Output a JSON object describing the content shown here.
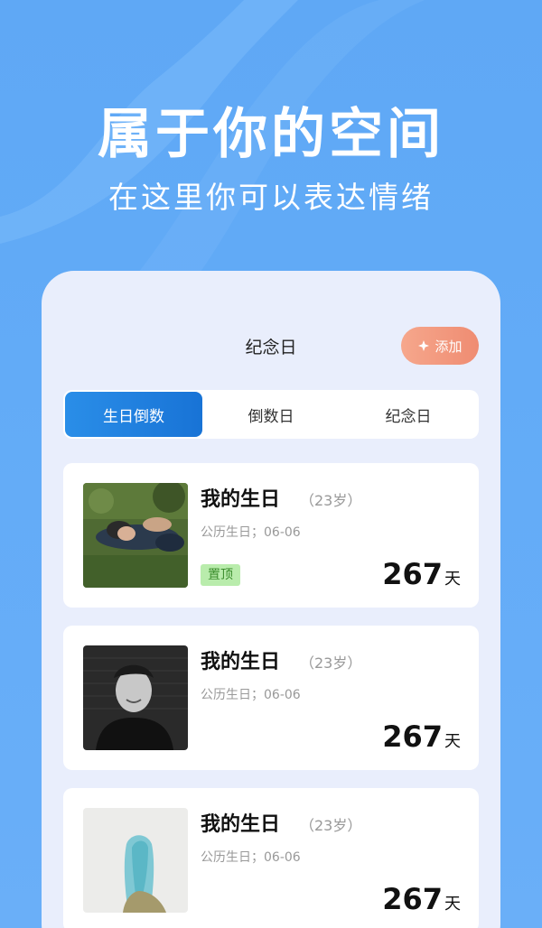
{
  "hero": {
    "title": "属于你的空间",
    "subtitle": "在这里你可以表达情绪"
  },
  "panel": {
    "title": "纪念日",
    "add_button": {
      "label": "添加",
      "icon": "plus-icon"
    }
  },
  "tabs": [
    {
      "label": "生日倒数",
      "active": true
    },
    {
      "label": "倒数日",
      "active": false
    },
    {
      "label": "纪念日",
      "active": false
    }
  ],
  "cards": [
    {
      "name": "我的生日",
      "age": "（23岁）",
      "date": "公历生日；06-06",
      "badge": "置顶",
      "count": "267",
      "unit": "天",
      "avatar": "photo-couple-on-grass"
    },
    {
      "name": "我的生日",
      "age": "（23岁）",
      "date": "公历生日；06-06",
      "badge": "",
      "count": "267",
      "unit": "天",
      "avatar": "photo-smiling-person-bw"
    },
    {
      "name": "我的生日",
      "age": "（23岁）",
      "date": "公历生日；06-06",
      "badge": "",
      "count": "267",
      "unit": "天",
      "avatar": "photo-blue-hair-person"
    }
  ],
  "colors": {
    "background": "#62abf7",
    "active_tab": "#1e80e0",
    "add_button": "#ef8c72",
    "pin_badge": "#b9ecac"
  }
}
